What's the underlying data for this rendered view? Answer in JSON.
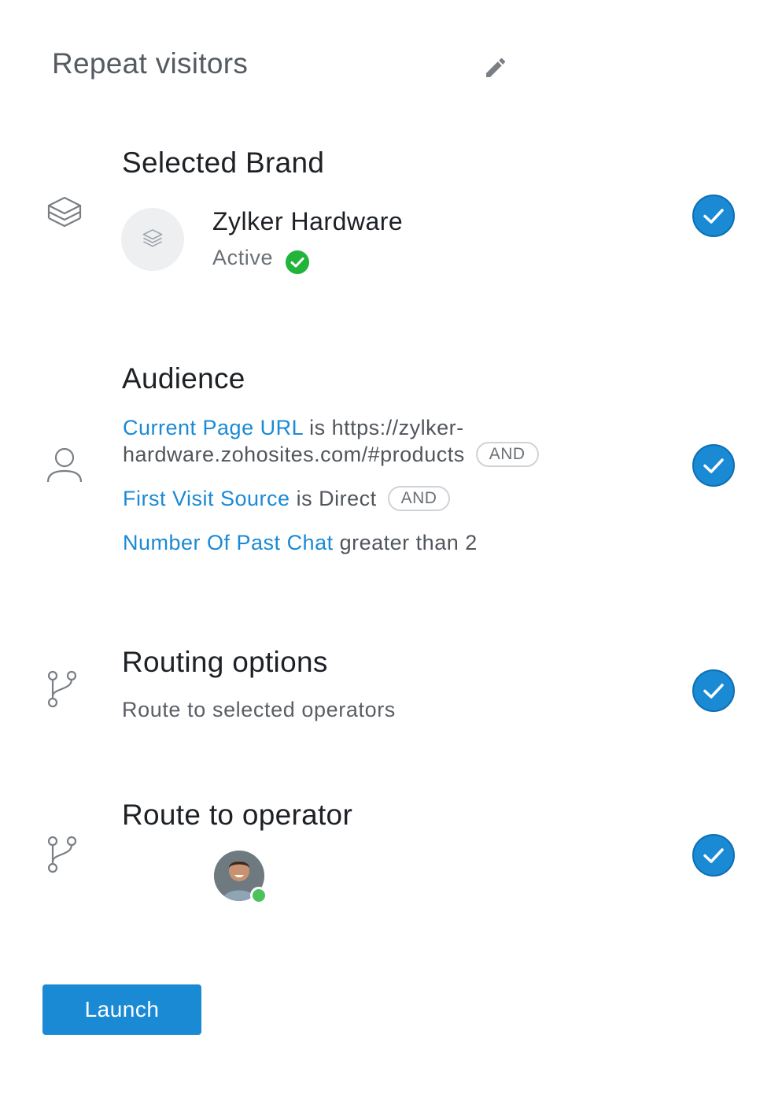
{
  "header": {
    "title": "Repeat visitors",
    "edit_icon": "pencil-icon"
  },
  "brand_section": {
    "title": "Selected Brand",
    "icon": "layers-icon",
    "brand_name": "Zylker Hardware",
    "status": "Active",
    "status_color": "#22b33b"
  },
  "audience_section": {
    "title": "Audience",
    "icon": "user-icon",
    "conditions": [
      {
        "field": "Current Page URL",
        "operator_value_line1": "is https://zylker-",
        "line2": "hardware.zohosites.com/#products",
        "joiner": "AND"
      },
      {
        "field": "First Visit Source",
        "operator_value": "is Direct",
        "joiner": "AND"
      },
      {
        "field": "Number Of Past Chat",
        "operator_value": "greater than 2"
      }
    ]
  },
  "routing_section": {
    "title": "Routing options",
    "icon": "branch-icon",
    "description": "Route to selected operators"
  },
  "operator_section": {
    "title": "Route to operator",
    "icon": "branch-icon",
    "operator_status": "online"
  },
  "footer": {
    "launch_label": "Launch"
  },
  "colors": {
    "accent": "#1a8ad5",
    "check_fill": "#1a8ad5",
    "online": "#4cc25a"
  }
}
